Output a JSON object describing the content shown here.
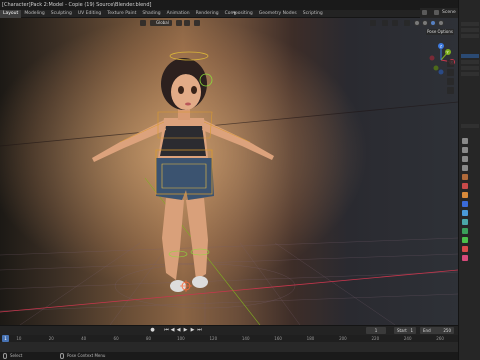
{
  "window": {
    "title": "[Character]Pack 2:Model - Copie (19) Source\\Blender.blend]"
  },
  "workspaces": {
    "tabs": [
      {
        "label": "Layout",
        "active": true
      },
      {
        "label": "Modeling",
        "active": false
      },
      {
        "label": "Sculpting",
        "active": false
      },
      {
        "label": "UV Editing",
        "active": false
      },
      {
        "label": "Texture Paint",
        "active": false
      },
      {
        "label": "Shading",
        "active": false
      },
      {
        "label": "Animation",
        "active": false
      },
      {
        "label": "Rendering",
        "active": false
      },
      {
        "label": "Compositing",
        "active": false
      },
      {
        "label": "Geometry Nodes",
        "active": false
      },
      {
        "label": "Scripting",
        "active": false
      }
    ],
    "add_label": "+"
  },
  "scene_selector": {
    "label": "Scene"
  },
  "viewport": {
    "mode_label": "Global",
    "pose_options_label": "Pose Options",
    "gizmo_axes": {
      "x": "X",
      "y": "Y",
      "z": "Z"
    },
    "colors": {
      "x_axis": "#c8364d",
      "y_axis": "#7fb01f",
      "z_axis": "#3d7ae0",
      "bone": "#d99a2e",
      "control": "#8ddc3a"
    }
  },
  "timeline": {
    "current_frame": "1",
    "start_label": "Start",
    "start_value": "1",
    "end_label": "End",
    "end_value": "250",
    "ruler_ticks": [
      "10",
      "20",
      "40",
      "60",
      "80",
      "100",
      "120",
      "140",
      "160",
      "180",
      "200",
      "220",
      "240",
      "260"
    ],
    "playback_icons": [
      "jump-start",
      "prev-key",
      "play-reverse",
      "play",
      "next-key",
      "jump-end"
    ]
  },
  "statusbar": {
    "left_label": "Select",
    "right_label": "Pose Context Menu"
  }
}
